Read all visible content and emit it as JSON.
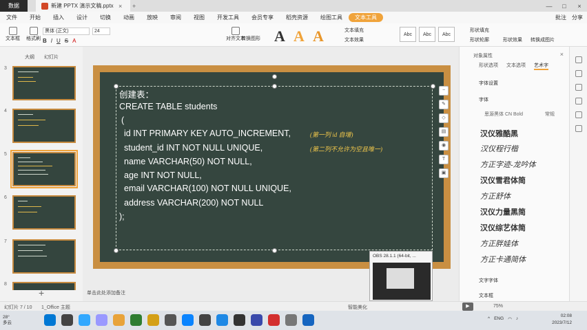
{
  "titlebar": {
    "app_label": "数据",
    "doc_title": "新建 PPTX 演示文稿.pptx",
    "close": "×",
    "add": "+",
    "minimize": "—",
    "maximize": "□",
    "win_close": "×"
  },
  "menu": {
    "items": [
      "文件",
      "开始",
      "插入",
      "设计",
      "切换",
      "动画",
      "放映",
      "审阅",
      "视图",
      "开发工具",
      "会员专享",
      "稻壳资源",
      "绘图工具",
      "文本工具"
    ],
    "right_items": [
      "批注",
      "分享"
    ]
  },
  "ribbon": {
    "font_name": "黑体 (正文)",
    "font_size": "24",
    "groups": [
      "文本框",
      "格式刷",
      "对齐文本",
      "转换图形",
      "文本填充",
      "文本效果",
      "形状填充",
      "形状轮廓",
      "形状效果",
      "转换成图片"
    ],
    "style_samples": [
      "Abc",
      "Abc",
      "Abc"
    ],
    "accent": "#f0a33a"
  },
  "left_panel": {
    "tabs": [
      "大纲",
      "幻灯片"
    ],
    "slide_numbers": [
      "3",
      "4",
      "5",
      "6",
      "7",
      "8"
    ],
    "add_label": "+"
  },
  "slide": {
    "lines": [
      "创建表：",
      "CREATE TABLE students",
      "(",
      "id INT PRIMARY KEY AUTO_INCREMENT,",
      "student_id INT NOT NULL UNIQUE,",
      "name VARCHAR(50) NOT NULL,",
      "age INT NOT NULL,",
      "email VARCHAR(100) NOT NULL UNIQUE,",
      "address VARCHAR(200) NOT NULL",
      ");"
    ],
    "annotations": [
      "(第一列 id 自增)",
      "(第二列不允许为空且唯一)"
    ],
    "board_color": "#35463f",
    "frame_color": "#c98f42",
    "notes_placeholder": "单击此处添加备注"
  },
  "obs_window": {
    "title": "OBS 28.1.1 (64-bit, ..."
  },
  "right_panel": {
    "title": "对象属性",
    "tabs": [
      "形状选项",
      "文本选项",
      "艺术字"
    ],
    "sections": [
      "字体设置",
      "字体"
    ],
    "sub_left": "思源黑体 CN Bold",
    "sub_right": "常规",
    "font_samples": [
      "汉仪雅酷黑",
      "汉仪程行楷",
      "方正字迹-龙吟体",
      "汉仪雪君体简",
      "方正舒体",
      "汉仪力量黑简",
      "汉仪综艺体简",
      "方正胖娃体",
      "方正卡通简体"
    ],
    "bottom_sections": [
      "文字字体",
      "文本框"
    ]
  },
  "status": {
    "slide_info": "幻灯片 7 / 10",
    "theme": "1_Office 主题",
    "smart": "智能美化",
    "zoom": "75%"
  },
  "taskbar": {
    "weather_temp": "28°",
    "weather_desc": "多云",
    "lang": "ENG",
    "time": "02:08",
    "date": "2023/7/12"
  }
}
